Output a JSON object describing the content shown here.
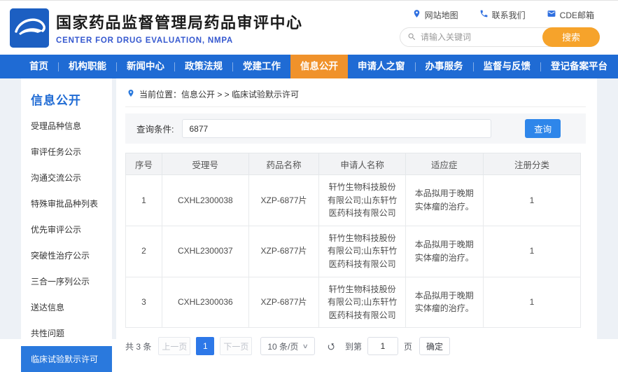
{
  "header": {
    "title": "国家药品监督管理局药品审评中心",
    "subtitle": "CENTER FOR DRUG EVALUATION, NMPA",
    "quick_links": [
      {
        "icon": "location-pin-icon",
        "label": "网站地图"
      },
      {
        "icon": "phone-icon",
        "label": "联系我们"
      },
      {
        "icon": "mail-icon",
        "label": "CDE邮箱"
      }
    ],
    "search": {
      "placeholder": "请输入关键词",
      "button_label": "搜索"
    }
  },
  "nav": {
    "items": [
      {
        "label": "首页",
        "active": false
      },
      {
        "label": "机构职能",
        "active": false
      },
      {
        "label": "新闻中心",
        "active": false
      },
      {
        "label": "政策法规",
        "active": false
      },
      {
        "label": "党建工作",
        "active": false
      },
      {
        "label": "信息公开",
        "active": true
      },
      {
        "label": "申请人之窗",
        "active": false
      },
      {
        "label": "办事服务",
        "active": false
      },
      {
        "label": "监督与反馈",
        "active": false
      },
      {
        "label": "登记备案平台",
        "active": false
      }
    ]
  },
  "sidebar": {
    "title": "信息公开",
    "items": [
      {
        "label": "受理品种信息",
        "active": false
      },
      {
        "label": "审评任务公示",
        "active": false
      },
      {
        "label": "沟通交流公示",
        "active": false
      },
      {
        "label": "特殊审批品种列表",
        "active": false
      },
      {
        "label": "优先审评公示",
        "active": false
      },
      {
        "label": "突破性治疗公示",
        "active": false
      },
      {
        "label": "三合一序列公示",
        "active": false
      },
      {
        "label": "送达信息",
        "active": false
      },
      {
        "label": "共性问题",
        "active": false
      },
      {
        "label": "临床试验默示许可",
        "active": true
      }
    ]
  },
  "main": {
    "breadcrumb": "当前位置：信息公开 > > 临床试验默示许可",
    "query": {
      "label": "查询条件:",
      "value": "6877",
      "button_label": "查询"
    },
    "table": {
      "headers": [
        "序号",
        "受理号",
        "药品名称",
        "申请人名称",
        "适应症",
        "注册分类"
      ],
      "rows": [
        [
          "1",
          "CXHL2300038",
          "XZP-6877片",
          "轩竹生物科技股份有限公司;山东轩竹医药科技有限公司",
          "本品拟用于晚期实体瘤的治疗。",
          "1"
        ],
        [
          "2",
          "CXHL2300037",
          "XZP-6877片",
          "轩竹生物科技股份有限公司;山东轩竹医药科技有限公司",
          "本品拟用于晚期实体瘤的治疗。",
          "1"
        ],
        [
          "3",
          "CXHL2300036",
          "XZP-6877片",
          "轩竹生物科技股份有限公司;山东轩竹医药科技有限公司",
          "本品拟用于晚期实体瘤的治疗。",
          "1"
        ]
      ]
    },
    "pagination": {
      "total_text": "共 3 条",
      "prev_label": "上一页",
      "current_page": "1",
      "next_label": "下一页",
      "page_size": "10 条/页",
      "goto_prefix": "到第",
      "goto_value": "1",
      "goto_suffix": "页",
      "confirm_label": "确定"
    }
  },
  "colors": {
    "nav_blue": "#1f6bd4",
    "nav_active_orange": "#f0922b",
    "search_button_orange": "#f6a32b",
    "sidebar_active_blue": "#2a79dd",
    "primary_button_blue": "#2e86ea",
    "pagination_current_blue": "#2d78e8",
    "subtitle_blue": "#3558cf",
    "logo_blue": "#1c5fc2"
  }
}
